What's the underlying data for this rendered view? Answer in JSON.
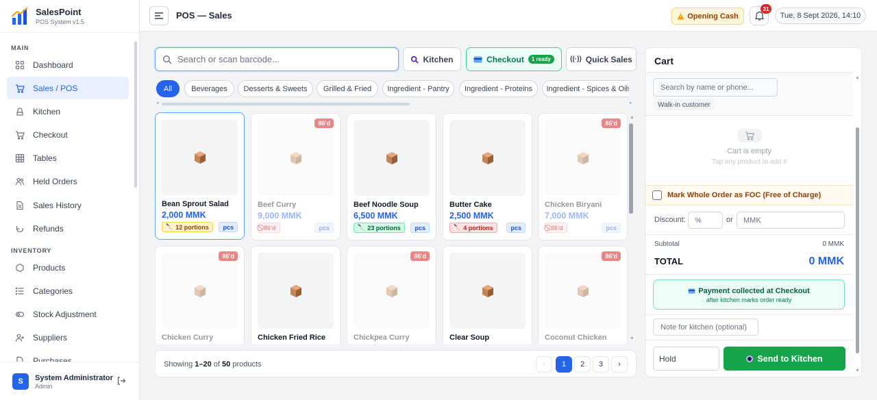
{
  "brand": {
    "name": "SalesPoint",
    "version": "POS System v1.5"
  },
  "nav": {
    "sections": [
      {
        "label": "MAIN"
      },
      {
        "label": "INVENTORY"
      }
    ],
    "items": [
      {
        "label": "Dashboard",
        "icon": "grid-icon"
      },
      {
        "label": "Sales / POS",
        "icon": "cart-icon",
        "active": true
      },
      {
        "label": "Kitchen",
        "icon": "chef-icon"
      },
      {
        "label": "Checkout",
        "icon": "cart-icon"
      },
      {
        "label": "Tables",
        "icon": "table-icon"
      },
      {
        "label": "Held Orders",
        "icon": "users-icon"
      },
      {
        "label": "Sales History",
        "icon": "document-icon"
      },
      {
        "label": "Refunds",
        "icon": "refund-icon"
      },
      {
        "label": "Products",
        "icon": "hexagon-icon"
      },
      {
        "label": "Categories",
        "icon": "list-icon"
      },
      {
        "label": "Stock Adjustment",
        "icon": "toggle-icon"
      },
      {
        "label": "Suppliers",
        "icon": "user-plus-icon"
      },
      {
        "label": "Purchases",
        "icon": "document-icon"
      }
    ]
  },
  "user": {
    "initial": "S",
    "name": "System Administrator",
    "role": "Admin"
  },
  "header": {
    "title": "POS — Sales",
    "opening_cash": "Opening Cash",
    "notifications": "31",
    "datetime": "Tue, 8 Sept 2026, 14:10"
  },
  "toolbar": {
    "search_placeholder": "Search or scan barcode...",
    "kitchen": "Kitchen",
    "checkout": "Checkout",
    "checkout_badge": "1 ready",
    "quick_sales": "Quick Sales"
  },
  "categories": [
    "All",
    "Beverages",
    "Desserts & Sweets",
    "Grilled & Fried",
    "Ingredient - Pantry",
    "Ingredient - Proteins",
    "Ingredient - Spices & Oils"
  ],
  "products": [
    {
      "name": "Bean Sprout Salad",
      "price": "2,000 MMK",
      "stock": "12 portions",
      "stock_type": "yellow",
      "unit": "pcs",
      "unavailable": false,
      "selected": true
    },
    {
      "name": "Beef Curry",
      "price": "9,000 MMK",
      "stock": "86'd",
      "stock_type": "red",
      "unit": "pcs",
      "unavailable": true,
      "badge": "86'd"
    },
    {
      "name": "Beef Noodle Soup",
      "price": "6,500 MMK",
      "stock": "23 portions",
      "stock_type": "green",
      "unit": "pcs",
      "unavailable": false
    },
    {
      "name": "Butter Cake",
      "price": "2,500 MMK",
      "stock": "4 portions",
      "stock_type": "red",
      "unit": "pcs",
      "unavailable": false
    },
    {
      "name": "Chicken Biryani",
      "price": "7,000 MMK",
      "stock": "86'd",
      "stock_type": "red",
      "unit": "pcs",
      "unavailable": true,
      "badge": "86'd"
    },
    {
      "name": "Chicken Curry",
      "unavailable": true,
      "badge": "86'd"
    },
    {
      "name": "Chicken Fried Rice",
      "unavailable": false
    },
    {
      "name": "Chickpea Curry",
      "unavailable": true,
      "badge": "86'd"
    },
    {
      "name": "Clear Soup",
      "unavailable": false
    },
    {
      "name": "Coconut Chicken",
      "unavailable": true,
      "badge": "86'd"
    }
  ],
  "pagination": {
    "prefix": "Showing ",
    "range": "1–20",
    "mid": " of ",
    "total": "50",
    "suffix": " products",
    "prev": "‹",
    "pages": [
      "1",
      "2",
      "3"
    ],
    "next": "›"
  },
  "cart": {
    "title": "Cart",
    "customer_placeholder": "Search by name or phone...",
    "customer_tag": "Walk-in customer",
    "empty_title": "Cart is empty",
    "empty_sub": "Tap any product to add it",
    "foc_label": "Mark Whole Order as FOC (Free of Charge)",
    "discount_label": "Discount:",
    "discount_pct_placeholder": "%",
    "discount_or": "or",
    "discount_mmk_placeholder": "MMK",
    "subtotal_label": "Subtotal",
    "subtotal_value": "0 MMK",
    "total_label": "TOTAL",
    "total_value": "0 MMK",
    "payment_title": "Payment collected at Checkout",
    "payment_sub": "after kitchen marks order ready",
    "note_placeholder": "Note for kitchen (optional)",
    "hold_placeholder": "Hold",
    "send_label": "Send to Kitchen"
  },
  "colors": {
    "accent": "#2563eb",
    "success": "#16a34a",
    "danger": "#dc2626",
    "warning": "#fef6d8"
  }
}
